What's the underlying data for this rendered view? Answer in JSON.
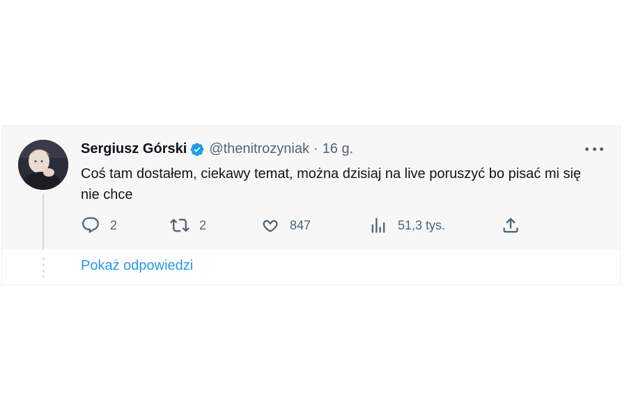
{
  "tweet": {
    "author_name": "Sergiusz Górski",
    "handle": "@thenitrozyniak",
    "separator": "·",
    "time": "16 g.",
    "text": "Coś tam dostałem, ciekawy temat, można dzisiaj na live poruszyć bo pisać mi się nie chce",
    "verified_color": "#1d9bf0",
    "avatar_icon": "avatar-photo",
    "more_icon": "more-horizontal-icon"
  },
  "actions": {
    "reply_count": "2",
    "retweet_count": "2",
    "like_count": "847",
    "views_count": "51,3 tys."
  },
  "thread": {
    "show_replies_label": "Pokaż odpowiedzi"
  },
  "colors": {
    "accent": "#1d9bf0",
    "muted": "#536471",
    "text": "#0f1419",
    "tweet_bg": "#f7f7f7"
  }
}
